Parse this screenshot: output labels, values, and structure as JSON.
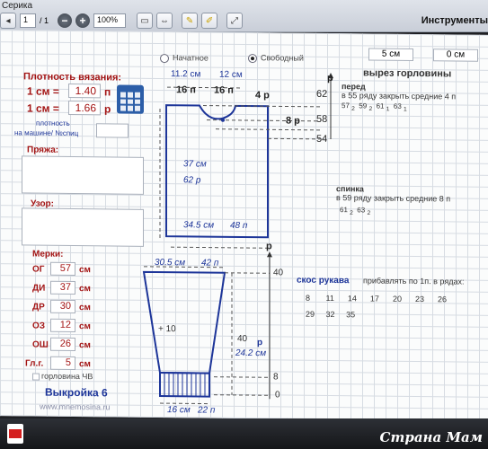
{
  "window": {
    "title": "Серика"
  },
  "toolbar": {
    "page_current": "1",
    "page_total": "/ 1",
    "zoom": "100%",
    "tools_label": "Инструменты"
  },
  "header_fields": {
    "val1": "5 см",
    "val2": "0 см"
  },
  "density": {
    "title": "Плотность вязания:",
    "row1_label": "1 см =",
    "row1_value": "1.40",
    "row1_unit": "п",
    "row2_label": "1 см =",
    "row2_value": "1.66",
    "row2_unit": "р",
    "machine_label_1": "плотность",
    "machine_label_2": "на машине/ №спиц"
  },
  "yarn_label": "Пряжа:",
  "pattern_label": "Узор:",
  "measurements": {
    "title": "Мерки:",
    "items": [
      {
        "label": "ОГ",
        "value": "57",
        "unit": "см"
      },
      {
        "label": "ДИ",
        "value": "37",
        "unit": "см"
      },
      {
        "label": "ДР",
        "value": "30",
        "unit": "см"
      },
      {
        "label": "ОЗ",
        "value": "12",
        "unit": "см"
      },
      {
        "label": "ОШ",
        "value": "26",
        "unit": "см"
      },
      {
        "label": "Гл.г.",
        "value": "5",
        "unit": "см"
      }
    ],
    "checkbox_label": "горловина ЧВ"
  },
  "pattern_title": "Выкройка 6",
  "site": "www.mnemosina.ru",
  "radios": {
    "opt1": "Начатное",
    "opt2": "Свободный"
  },
  "neckline": {
    "title": "вырез горловины",
    "front_label": "перед",
    "front_line": "в 55 ряду закрыть средние 4 п",
    "front_seq": [
      "57",
      "2",
      "59",
      "2",
      "61",
      "1",
      "63",
      "1"
    ],
    "back_label": "спинка",
    "back_line": "в 59 ряду закрыть средние 8 п",
    "back_seq": [
      "61",
      "2",
      "63",
      "2"
    ]
  },
  "sleeve": {
    "title": "скос рукава",
    "note": "прибавлять по 1п. в рядах:",
    "row1": [
      "8",
      "11",
      "14",
      "17",
      "20",
      "23",
      "26"
    ],
    "row2": [
      "29",
      "32",
      "35"
    ]
  },
  "body_dims": {
    "w_cm_top": "11.2 см",
    "w_cm_top2": "12 см",
    "w_p_left": "16 п",
    "w_p_right": "16 п",
    "neck_p": "4 р",
    "neck_8p": "8 р",
    "height_cm": "37 см",
    "height_p": "62 р",
    "width_bottom_cm": "34.5 см",
    "width_bottom_p": "48 п",
    "r62": "62",
    "r58": "58",
    "r54": "54",
    "p_label": "р"
  },
  "sleeve_dims": {
    "top_cm": "30.5 см",
    "top_p": "42 п",
    "plus10": "+ 10",
    "height_cm": "40",
    "height_p": "р",
    "height_cm2": "24.2 см",
    "bottom_cm": "16 см",
    "bottom_p": "22 п",
    "r40": "40",
    "r8": "8",
    "r0": "0",
    "p_label": "р"
  },
  "watermark": "Страна Мам"
}
